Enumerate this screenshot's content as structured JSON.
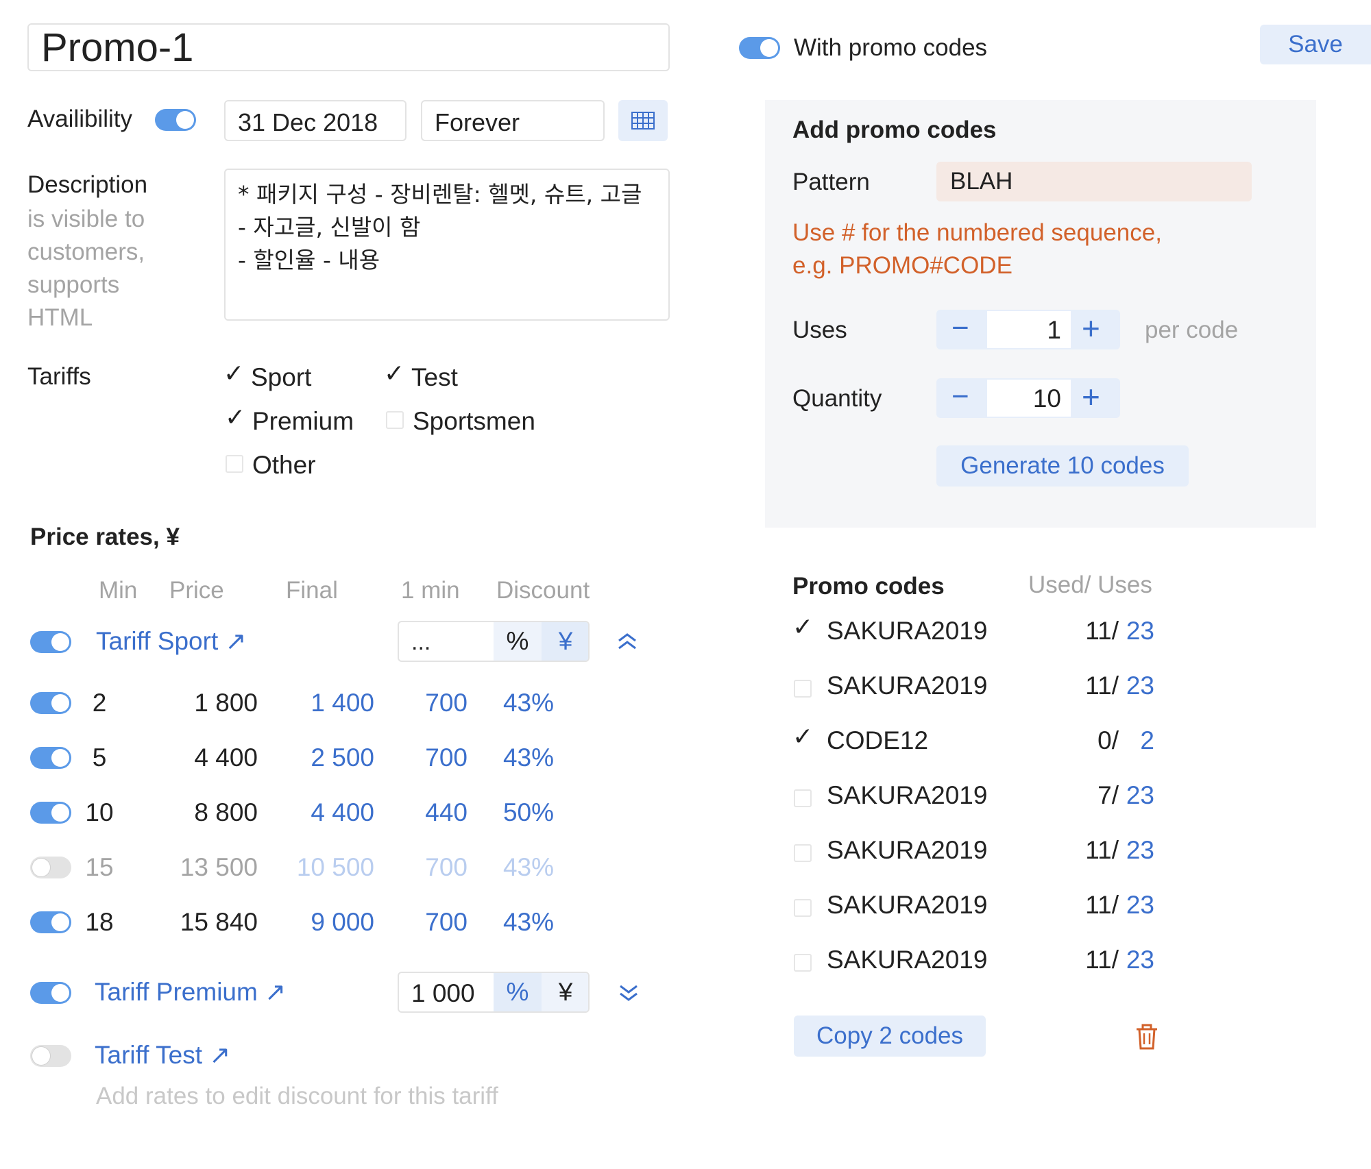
{
  "promo": {
    "title": "Promo-1",
    "with_promo_codes_label": "With promo codes",
    "save_label": "Save"
  },
  "availability": {
    "label": "Availibility",
    "start_date": "31 Dec 2018",
    "end_date": "Forever"
  },
  "description": {
    "label": "Description",
    "hint_lines": [
      "is visible to",
      "customers,",
      "supports",
      "HTML"
    ],
    "text_lines": [
      "* 패키지 구성 - 장비렌탈: 헬멧, 슈트, 고글",
      "- 자고글, 신발이 함",
      "- 할인율 - 내용"
    ]
  },
  "tariffs": {
    "label": "Tariffs",
    "items": [
      {
        "label": "Sport",
        "checked": true
      },
      {
        "label": "Test",
        "checked": true
      },
      {
        "label": "Premium",
        "checked": true
      },
      {
        "label": "Sportsmen",
        "checked": false
      },
      {
        "label": "Other",
        "checked": false
      }
    ]
  },
  "price_rates": {
    "title": "Price rates, ¥",
    "columns": [
      "Min",
      "Price",
      "Final",
      "1 min",
      "Discount"
    ],
    "sport": {
      "name": "Tariff Sport ↗",
      "input_value": "...",
      "unit_percent": "%",
      "unit_yen": "¥",
      "rows": [
        {
          "min": "2",
          "price": "1 800",
          "final": "1 400",
          "one_min": "700",
          "discount": "43%",
          "enabled": true
        },
        {
          "min": "5",
          "price": "4 400",
          "final": "2 500",
          "one_min": "700",
          "discount": "43%",
          "enabled": true
        },
        {
          "min": "10",
          "price": "8 800",
          "final": "4 400",
          "one_min": "440",
          "discount": "50%",
          "enabled": true
        },
        {
          "min": "15",
          "price": "13 500",
          "final": "10 500",
          "one_min": "700",
          "discount": "43%",
          "enabled": false
        },
        {
          "min": "18",
          "price": "15 840",
          "final": "9 000",
          "one_min": "700",
          "discount": "43%",
          "enabled": true
        }
      ]
    },
    "premium": {
      "name": "Tariff Premium ↗",
      "input_value": "1 000",
      "unit_percent": "%",
      "unit_yen": "¥"
    },
    "test": {
      "name": "Tariff Test ↗",
      "hint": "Add rates to edit discount for this tariff"
    }
  },
  "add_promo": {
    "title": "Add promo codes",
    "pattern_label": "Pattern",
    "pattern_value": "BLAH",
    "hint_line1": "Use # for the numbered sequence,",
    "hint_line2": "e.g. PROMO#CODE",
    "uses_label": "Uses",
    "uses_value": "1",
    "uses_suffix": "per code",
    "quantity_label": "Quantity",
    "quantity_value": "10",
    "minus": "−",
    "plus": "+",
    "generate_label": "Generate 10 codes"
  },
  "promo_codes": {
    "title": "Promo codes",
    "used_uses_header": "Used/ Uses",
    "rows": [
      {
        "code": "SAKURA2019",
        "used": "11/",
        "uses": "23",
        "checked": true
      },
      {
        "code": "SAKURA2019",
        "used": "11/",
        "uses": "23",
        "checked": false
      },
      {
        "code": "CODE12",
        "used": "0/",
        "uses": "2",
        "checked": true
      },
      {
        "code": "SAKURA2019",
        "used": "7/",
        "uses": "23",
        "checked": false
      },
      {
        "code": "SAKURA2019",
        "used": "11/",
        "uses": "23",
        "checked": false
      },
      {
        "code": "SAKURA2019",
        "used": "11/",
        "uses": "23",
        "checked": false
      },
      {
        "code": "SAKURA2019",
        "used": "11/",
        "uses": "23",
        "checked": false
      }
    ],
    "copy_label": "Copy 2 codes"
  },
  "colors": {
    "accent": "#3b6fcc",
    "toggle_on": "#5b9ae8",
    "hint_orange": "#d2612a",
    "panel_bg": "#f5f6f8",
    "pattern_bg": "#f5e9e4"
  },
  "icons": {
    "calendar": "calendar-icon",
    "collapse": "chevrons-up-icon",
    "expand": "chevrons-down-icon",
    "trash": "trash-icon"
  }
}
